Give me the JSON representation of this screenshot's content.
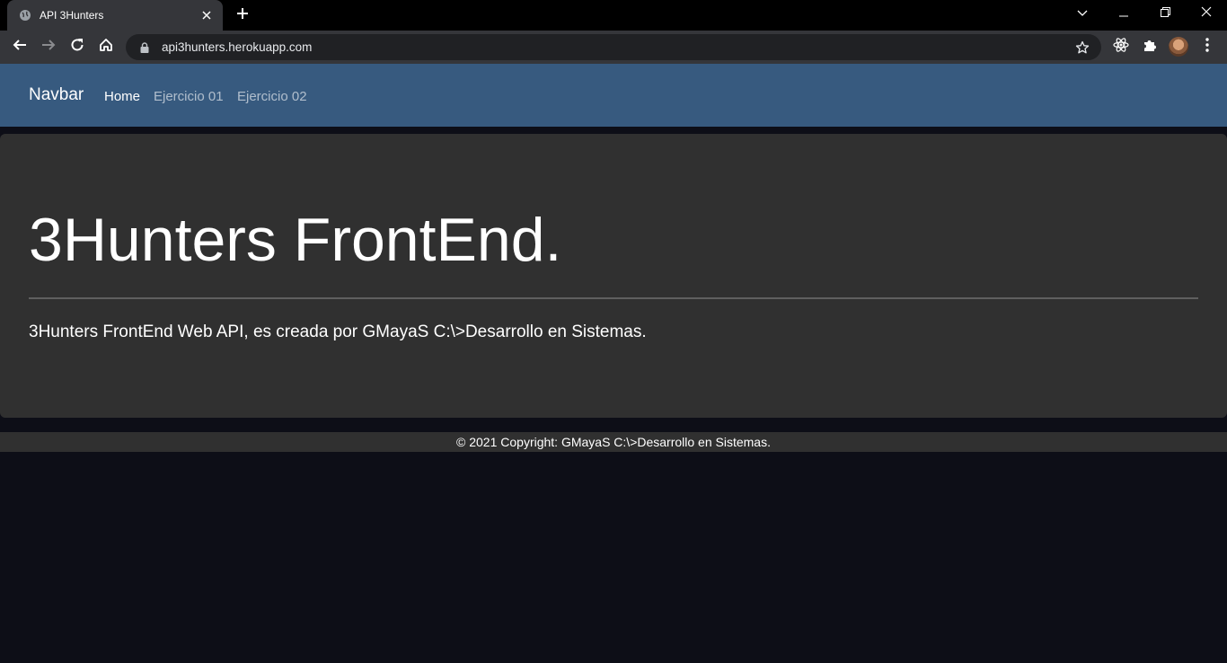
{
  "browser": {
    "tab_title": "API 3Hunters",
    "url": "api3hunters.herokuapp.com"
  },
  "navbar": {
    "brand": "Navbar",
    "links": [
      {
        "label": "Home",
        "active": true
      },
      {
        "label": "Ejercicio 01",
        "active": false
      },
      {
        "label": "Ejercicio 02",
        "active": false
      }
    ]
  },
  "hero": {
    "title": "3Hunters FrontEnd.",
    "lead": "3Hunters FrontEnd Web API, es creada por GMayaS C:\\>Desarrollo en Sistemas."
  },
  "footer": {
    "text": "© 2021 Copyright: GMayaS C:\\>Desarrollo en Sistemas."
  },
  "colors": {
    "navbar": "#375a7f",
    "page_background": "#0d0e17",
    "panel": "#303030"
  },
  "icons": [
    "globe-icon",
    "close-icon",
    "plus-icon",
    "chevron-down-icon",
    "minimize-icon",
    "restore-icon",
    "back-icon",
    "forward-icon",
    "reload-icon",
    "home-icon",
    "lock-icon",
    "star-icon",
    "react-icon",
    "puzzle-icon",
    "more-vert-icon"
  ]
}
